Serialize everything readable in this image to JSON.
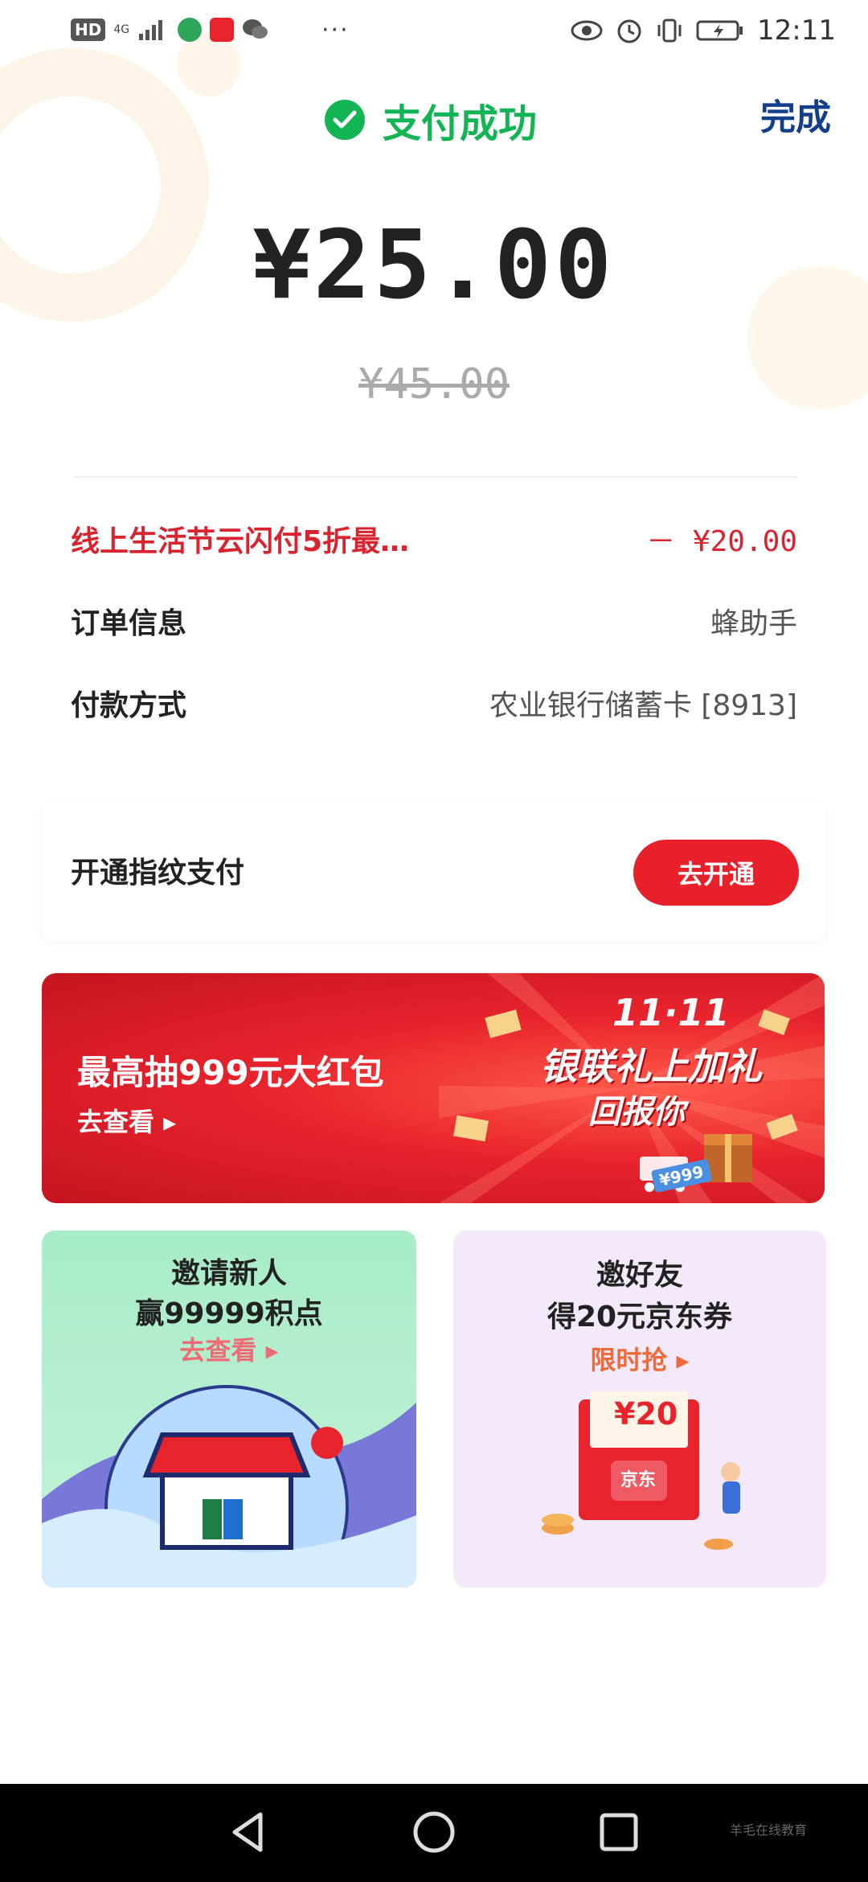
{
  "status_bar": {
    "left_hd": "HD",
    "left_net": "4G",
    "dots": "···",
    "time": "12:11",
    "icons": [
      "signal-icon",
      "app-icon",
      "app-red-icon",
      "wechat-icon",
      "eye-icon",
      "alarm-icon",
      "vibrate-icon",
      "battery-icon"
    ]
  },
  "header": {
    "status_text": "支付成功",
    "done_label": "完成",
    "status_color": "#13b454"
  },
  "payment": {
    "amount": "¥25.00",
    "original_amount": "¥45.00"
  },
  "details": {
    "promo_label": "线上生活节云闪付5折最…",
    "promo_value": "－ ¥20.00",
    "order_label": "订单信息",
    "order_value": "蜂助手",
    "method_label": "付款方式",
    "method_value": "农业银行储蓄卡 [8913]"
  },
  "fingerprint": {
    "label": "开通指纹支付",
    "button": "去开通"
  },
  "banner": {
    "title": "最高抽999元大红包",
    "link": "去查看 ▸",
    "slogan_line1": "11·11",
    "slogan_line2": "银联礼上加礼",
    "slogan_line3": "回报你",
    "tag": "¥999"
  },
  "cards": {
    "left": {
      "title_line1": "邀请新人",
      "title_line2": "赢99999积点",
      "link": "去查看 ▸"
    },
    "right": {
      "title_line1": "邀好友",
      "title_line2": "得20元京东券",
      "link": "限时抢 ▸",
      "coupon": "¥20",
      "brand": "京东"
    }
  },
  "nav": {
    "watermark": "羊毛在线教育"
  }
}
